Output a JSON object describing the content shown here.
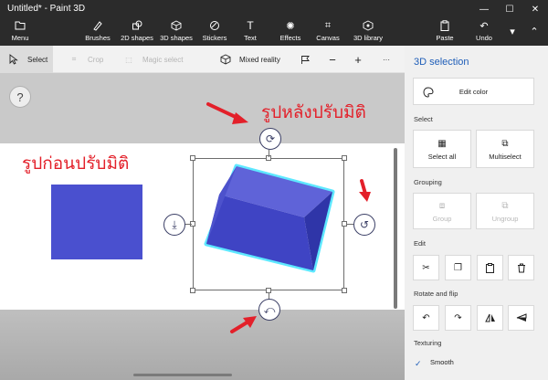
{
  "window": {
    "title": "Untitled* - Paint 3D",
    "controls": [
      "minimize",
      "maximize",
      "close"
    ]
  },
  "ribbon": {
    "menu": "Menu",
    "brushes": "Brushes",
    "shapes_2d": "2D shapes",
    "shapes_3d": "3D shapes",
    "stickers": "Stickers",
    "text": "Text",
    "effects": "Effects",
    "canvas": "Canvas",
    "library_3d": "3D library",
    "paste": "Paste",
    "undo": "Undo"
  },
  "toolbar": {
    "select": "Select",
    "crop": "Crop",
    "magic_select": "Magic select",
    "mixed_reality": "Mixed reality"
  },
  "canvas": {
    "help": "?",
    "annotation_after": "รูปหลังปรับมิติ",
    "annotation_before": "รูปก่อนปรับมิติ",
    "colors": {
      "shape": "#4a50cf",
      "arrow": "#e3202a",
      "glow": "#5ee8ff"
    }
  },
  "panel": {
    "title": "3D selection",
    "edit_color": "Edit color",
    "select_label": "Select",
    "select_all": "Select all",
    "multiselect": "Multiselect",
    "grouping_label": "Grouping",
    "group": "Group",
    "ungroup": "Ungroup",
    "edit_label": "Edit",
    "rotate_flip_label": "Rotate and flip",
    "texturing_label": "Texturing",
    "smooth": "Smooth",
    "smooth_checked": true
  }
}
